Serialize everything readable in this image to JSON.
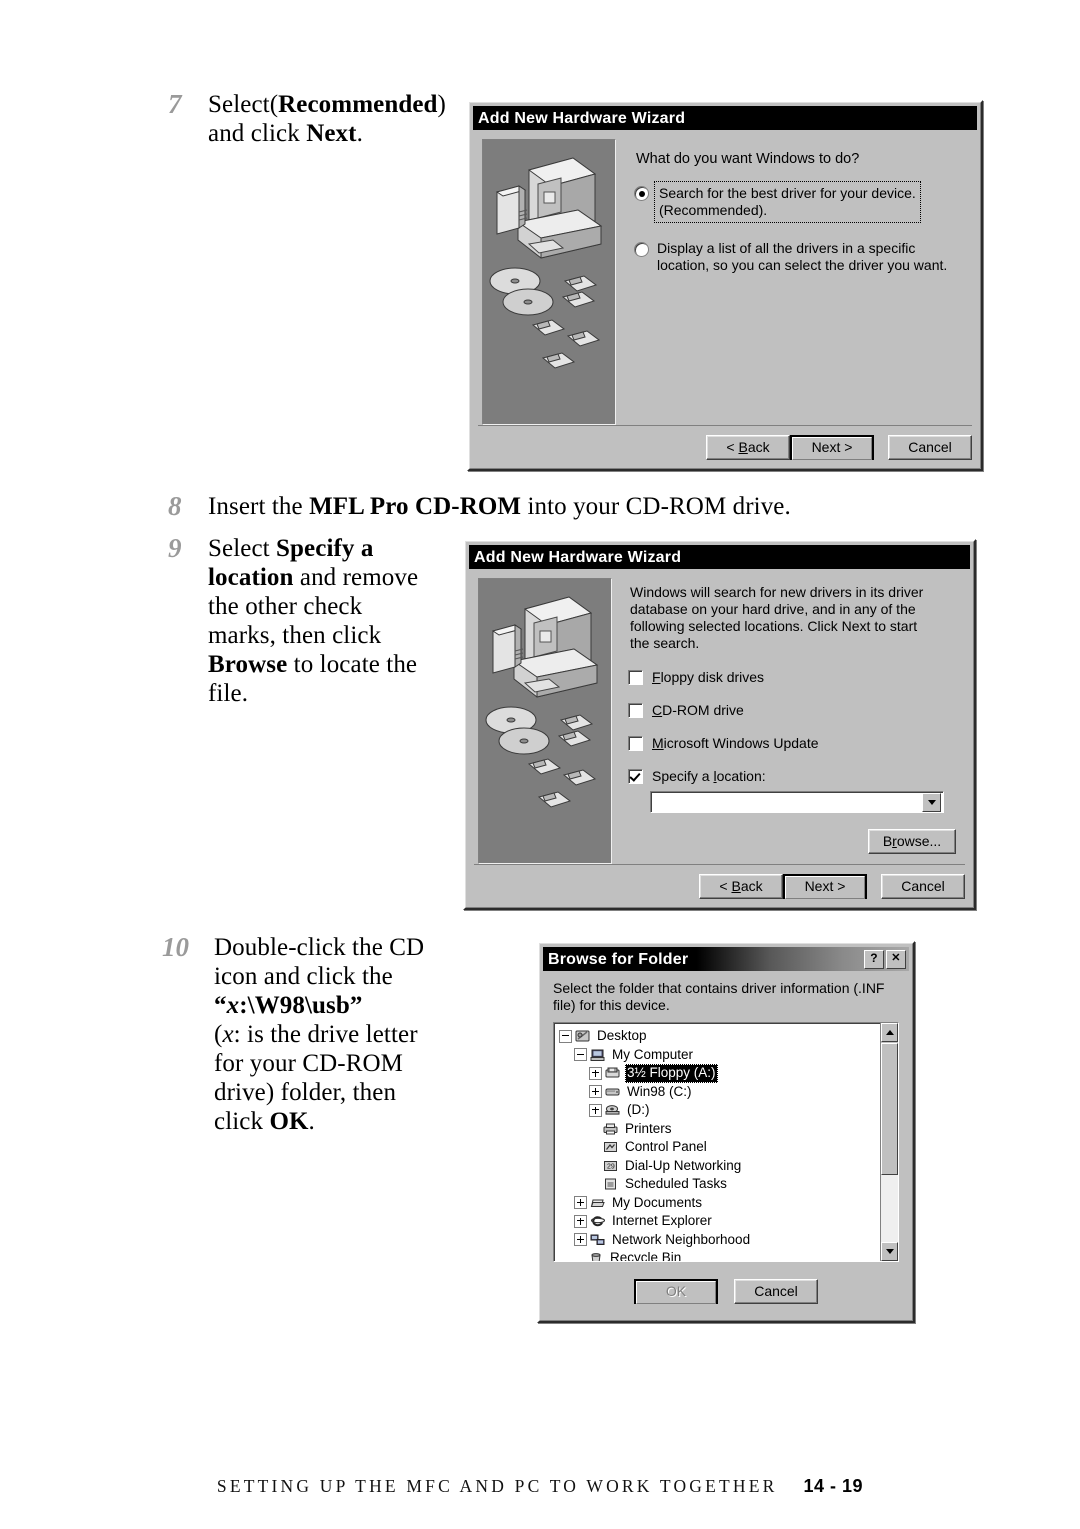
{
  "page": {
    "footer_title": "SETTING UP THE MFC AND PC TO WORK TOGETHER",
    "footer_page": "14 - 19"
  },
  "steps": {
    "step7": {
      "number": "7",
      "line1_a": "Select",
      "line1_b": "(",
      "line1_bold": "Recommended",
      "line1_c": ")",
      "line2_a": "and click ",
      "line2_bold": "Next",
      "line2_c": "."
    },
    "step8": {
      "number": "8",
      "a": "Insert the ",
      "bold": "MFL Pro CD-ROM",
      "b": " into your CD-ROM drive."
    },
    "step9": {
      "number": "9",
      "a": "Select ",
      "bold1": "Specify a location",
      "b": " and remove the other check marks, then click ",
      "bold2": "Browse",
      "c": " to locate the file."
    },
    "step10": {
      "number": "10",
      "a": "Double-click the CD icon and click the ",
      "quoted_path": "“x:\\W98\\usb”",
      "path_x": "x",
      "path_rest": ":\\W98\\usb",
      "b": "(",
      "ital_x": "x",
      "c": ": is the drive letter for your CD-ROM drive) folder, then click ",
      "bold": "OK",
      "d": "."
    }
  },
  "dialog1": {
    "title": "Add New Hardware Wizard",
    "question": "What do you want Windows to do?",
    "options": [
      {
        "label_line1": "Search for the best driver for your device.",
        "label_line2": "(Recommended).",
        "selected": true
      },
      {
        "label_line1": "Display a list of all the drivers in a specific",
        "label_line2": "location, so you can select the driver you want.",
        "selected": false
      }
    ],
    "buttons": {
      "back": "< Back",
      "back_u": "B",
      "back_pre": "< ",
      "back_post": "ack",
      "next": "Next >",
      "cancel": "Cancel"
    }
  },
  "dialog2": {
    "title": "Add New Hardware Wizard",
    "paragraph": "Windows will search for new drivers in its driver database on your hard drive, and in any of the following selected locations. Click Next to start the search.",
    "checkboxes": [
      {
        "u": "F",
        "pre": "",
        "post": "loppy disk drives",
        "checked": false
      },
      {
        "u": "C",
        "pre": "",
        "post": "D-ROM drive",
        "checked": false
      },
      {
        "u": "M",
        "pre": "",
        "post": "icrosoft Windows Update",
        "checked": false
      },
      {
        "u": "l",
        "pre": "Specify a ",
        "post": "ocation:",
        "checked": true
      }
    ],
    "location_value": "",
    "browse_button": {
      "pre": "B",
      "u": "r",
      "post": "owse..."
    },
    "buttons": {
      "back_pre": "< ",
      "back_u": "B",
      "back_post": "ack",
      "next": "Next >",
      "cancel": "Cancel"
    }
  },
  "dialog3": {
    "title": "Browse for Folder",
    "help_button": "?",
    "close_button": "✕",
    "instruction": "Select the folder that contains driver information (.INF file) for this device.",
    "tree": [
      {
        "label": "Desktop",
        "depth": 0,
        "expander": "minus",
        "icon": "desktop-icon",
        "selected": false
      },
      {
        "label": "My Computer",
        "depth": 1,
        "expander": "minus",
        "icon": "computer-icon",
        "selected": false
      },
      {
        "label": "3½ Floppy (A:)",
        "depth": 2,
        "expander": "plus",
        "icon": "floppy-icon",
        "selected": true
      },
      {
        "label": "Win98 (C:)",
        "depth": 2,
        "expander": "plus",
        "icon": "harddisk-icon",
        "selected": false
      },
      {
        "label": "(D:)",
        "depth": 2,
        "expander": "plus",
        "icon": "cdrom-icon",
        "selected": false
      },
      {
        "label": "Printers",
        "depth": 2,
        "expander": "none",
        "icon": "printers-icon",
        "selected": false
      },
      {
        "label": "Control Panel",
        "depth": 2,
        "expander": "none",
        "icon": "control-panel-icon",
        "selected": false
      },
      {
        "label": "Dial-Up Networking",
        "depth": 2,
        "expander": "none",
        "icon": "dialup-icon",
        "selected": false
      },
      {
        "label": "Scheduled Tasks",
        "depth": 2,
        "expander": "none",
        "icon": "tasks-icon",
        "selected": false
      },
      {
        "label": "My Documents",
        "depth": 1,
        "expander": "plus",
        "icon": "documents-icon",
        "selected": false
      },
      {
        "label": "Internet Explorer",
        "depth": 1,
        "expander": "plus",
        "icon": "ie-icon",
        "selected": false
      },
      {
        "label": "Network Neighborhood",
        "depth": 1,
        "expander": "plus",
        "icon": "network-icon",
        "selected": false
      },
      {
        "label": "Recycle Bin",
        "depth": 1,
        "expander": "none",
        "icon": "recycle-icon",
        "selected": false
      }
    ],
    "buttons": {
      "ok": "OK",
      "cancel": "Cancel"
    },
    "ok_disabled": true
  },
  "colors": {
    "dialog_face": "#c0c0c0",
    "titlebar": "#000000",
    "art_background": "#7d7d7d",
    "step_number": "#9a9a9a"
  }
}
